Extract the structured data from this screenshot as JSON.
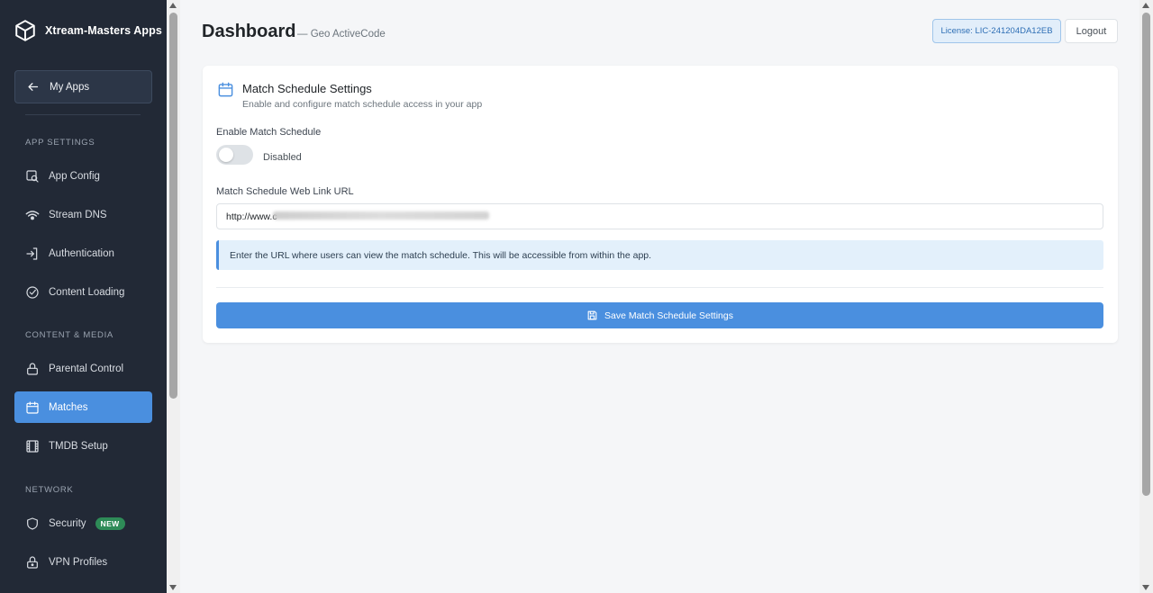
{
  "brand": {
    "title": "Xtream-Masters Apps"
  },
  "sidebar": {
    "back_label": "My Apps",
    "sections": {
      "app_settings": "APP SETTINGS",
      "content_media": "CONTENT & MEDIA",
      "network": "NETWORK"
    },
    "items": [
      {
        "label": "App Config",
        "icon": "search-config-icon"
      },
      {
        "label": "Stream DNS",
        "icon": "wifi-icon"
      },
      {
        "label": "Authentication",
        "icon": "login-icon"
      },
      {
        "label": "Content Loading",
        "icon": "check-circle-icon"
      },
      {
        "label": "Parental Control",
        "icon": "lock-icon"
      },
      {
        "label": "Matches",
        "icon": "calendar-icon",
        "active": true
      },
      {
        "label": "TMDB Setup",
        "icon": "film-icon"
      },
      {
        "label": "Security",
        "icon": "shield-icon",
        "badge": "NEW"
      },
      {
        "label": "VPN Profiles",
        "icon": "lock-keyhole-icon"
      }
    ]
  },
  "header": {
    "title": "Dashboard",
    "subtitle": "— Geo ActiveCode",
    "license": "License: LIC-241204DA12EB",
    "logout": "Logout"
  },
  "card": {
    "title": "Match Schedule Settings",
    "description": "Enable and configure match schedule access in your app",
    "enable_label": "Enable Match Schedule",
    "toggle_state": "Disabled",
    "url_label": "Match Schedule Web Link URL",
    "url_value": "http://www.c",
    "info_text": "Enter the URL where users can view the match schedule. This will be accessible from within the app.",
    "save_label": "Save Match Schedule Settings"
  },
  "colors": {
    "sidebar_bg": "#222936",
    "accent": "#4a8fdf",
    "badge_green": "#2e8b57",
    "page_bg": "#f5f6f8"
  }
}
